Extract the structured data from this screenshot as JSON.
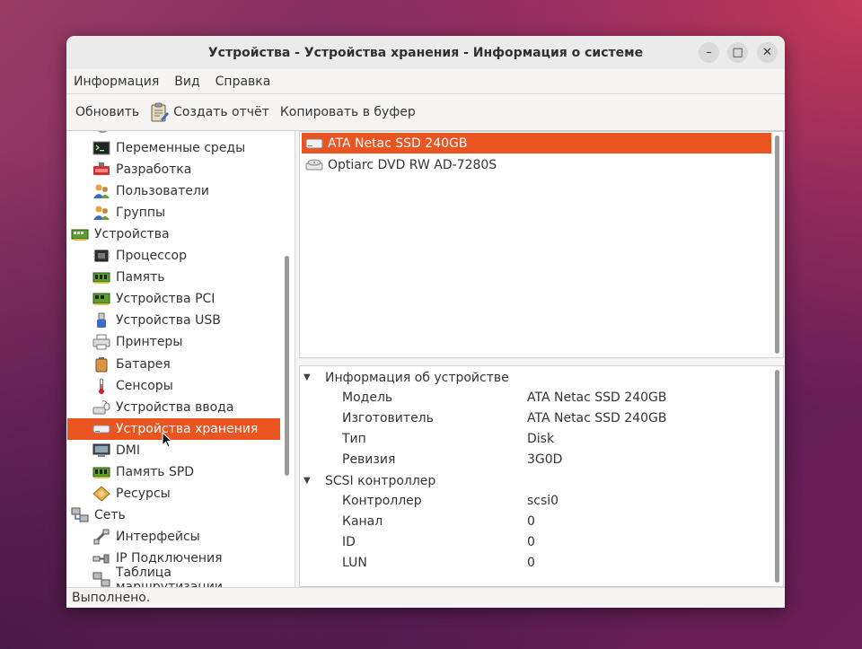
{
  "window": {
    "title": "Устройства - Устройства хранения - Информация о системе",
    "controls": {
      "minimize": "–",
      "maximize": "□",
      "close": "✕"
    }
  },
  "menu": [
    "Информация",
    "Вид",
    "Справка"
  ],
  "toolbar": {
    "refresh": "Обновить",
    "report": "Создать отчёт",
    "copy": "Копировать в буфер"
  },
  "tree": [
    {
      "label": "Переменные среды",
      "icon": "terminal-icon",
      "level": 1,
      "selected": false
    },
    {
      "label": "Разработка",
      "icon": "development-icon",
      "level": 1,
      "selected": false
    },
    {
      "label": "Пользователи",
      "icon": "users-icon",
      "level": 1,
      "selected": false
    },
    {
      "label": "Группы",
      "icon": "groups-icon",
      "level": 1,
      "selected": false
    },
    {
      "label": "Устройства",
      "icon": "devices-icon",
      "level": 0,
      "selected": false
    },
    {
      "label": "Процессор",
      "icon": "cpu-icon",
      "level": 1,
      "selected": false
    },
    {
      "label": "Память",
      "icon": "memory-icon",
      "level": 1,
      "selected": false
    },
    {
      "label": "Устройства PCI",
      "icon": "pci-icon",
      "level": 1,
      "selected": false
    },
    {
      "label": "Устройства USB",
      "icon": "usb-icon",
      "level": 1,
      "selected": false
    },
    {
      "label": "Принтеры",
      "icon": "printer-icon",
      "level": 1,
      "selected": false
    },
    {
      "label": "Батарея",
      "icon": "battery-icon",
      "level": 1,
      "selected": false
    },
    {
      "label": "Сенсоры",
      "icon": "thermometer-icon",
      "level": 1,
      "selected": false
    },
    {
      "label": "Устройства ввода",
      "icon": "input-devices-icon",
      "level": 1,
      "selected": false
    },
    {
      "label": "Устройства хранения",
      "icon": "storage-icon",
      "level": 1,
      "selected": true
    },
    {
      "label": "DMI",
      "icon": "dmi-icon",
      "level": 1,
      "selected": false
    },
    {
      "label": "Память SPD",
      "icon": "spd-icon",
      "level": 1,
      "selected": false
    },
    {
      "label": "Ресурсы",
      "icon": "resources-icon",
      "level": 1,
      "selected": false
    },
    {
      "label": "Сеть",
      "icon": "network-icon",
      "level": 0,
      "selected": false
    },
    {
      "label": "Интерфейсы",
      "icon": "interfaces-icon",
      "level": 1,
      "selected": false
    },
    {
      "label": "IP Подключения",
      "icon": "ip-connections-icon",
      "level": 1,
      "selected": false
    },
    {
      "label": "Таблица маршрутизации",
      "icon": "routing-table-icon",
      "level": 1,
      "selected": false
    }
  ],
  "devices": [
    {
      "label": "ATA Netac SSD 240GB",
      "icon": "drive-icon",
      "selected": true
    },
    {
      "label": "Optiarc DVD RW AD-7280S",
      "icon": "optical-drive-icon",
      "selected": false
    }
  ],
  "details": [
    {
      "title": "Информация об устройстве",
      "rows": [
        {
          "key": "Модель",
          "value": "ATA Netac SSD 240GB"
        },
        {
          "key": "Изготовитель",
          "value": "ATA Netac SSD 240GB"
        },
        {
          "key": "Тип",
          "value": "Disk"
        },
        {
          "key": "Ревизия",
          "value": "3G0D"
        }
      ]
    },
    {
      "title": "SCSI контроллер",
      "rows": [
        {
          "key": "Контроллер",
          "value": "scsi0"
        },
        {
          "key": "Канал",
          "value": "0"
        },
        {
          "key": "ID",
          "value": "0"
        },
        {
          "key": "LUN",
          "value": "0"
        }
      ]
    }
  ],
  "status": "Выполнено.",
  "colors": {
    "accent": "#e95420",
    "window_bg": "#f6f5f4"
  }
}
